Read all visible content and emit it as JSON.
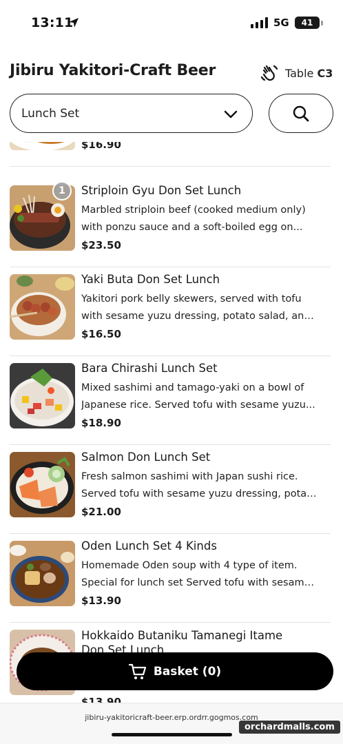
{
  "status_bar": {
    "time": "13:11",
    "network": "5G",
    "battery": "41"
  },
  "header": {
    "title": "Jibiru Yakitori-Craft Beer",
    "table_label": "Table",
    "table_number": "C3"
  },
  "category": {
    "selected": "Lunch Set"
  },
  "menu_items": [
    {
      "name": "",
      "desc_line1": "",
      "desc_line2": "",
      "price": "$16.90",
      "qty": ""
    },
    {
      "name": "Striploin Gyu Don Set Lunch",
      "desc_line1": "Marbled striploin beef (cooked medium only)",
      "desc_line2": "with ponzu sauce and a soft-boiled egg on...",
      "price": "$23.50",
      "qty": "1"
    },
    {
      "name": "Yaki Buta Don Set Lunch",
      "desc_line1": "Yakitori pork belly skewers, served with tofu",
      "desc_line2": "with sesame yuzu dressing, potato salad, and...",
      "price": "$16.50",
      "qty": ""
    },
    {
      "name": "Bara Chirashi Lunch Set",
      "desc_line1": "Mixed sashimi and tamago-yaki on a bowl of",
      "desc_line2": "Japanese rice. Served tofu with sesame yuzu...",
      "price": "$18.90",
      "qty": ""
    },
    {
      "name": "Salmon Don Lunch Set",
      "desc_line1": "Fresh salmon sashimi with Japan sushi rice.",
      "desc_line2": "Served tofu with sesame yuzu dressing, potat...",
      "price": "$21.00",
      "qty": ""
    },
    {
      "name": "Oden Lunch Set 4 Kinds",
      "desc_line1": "Homemade Oden soup with 4 type of item.",
      "desc_line2": "Special for lunch set Served tofu with sesame...",
      "price": "$13.90",
      "qty": ""
    },
    {
      "name": "Hokkaido Butaniku Tamanegi Itame",
      "desc_line1": "Don Set Lunch",
      "desc_line2": "",
      "price": "$13.90",
      "qty": ""
    }
  ],
  "basket": {
    "label": "Basket (0)"
  },
  "browser": {
    "url": "jibiru-yakitoricraft-beer.erp.ordrr.gogmos.com"
  },
  "watermark": {
    "text": "orchardmalls.com"
  }
}
